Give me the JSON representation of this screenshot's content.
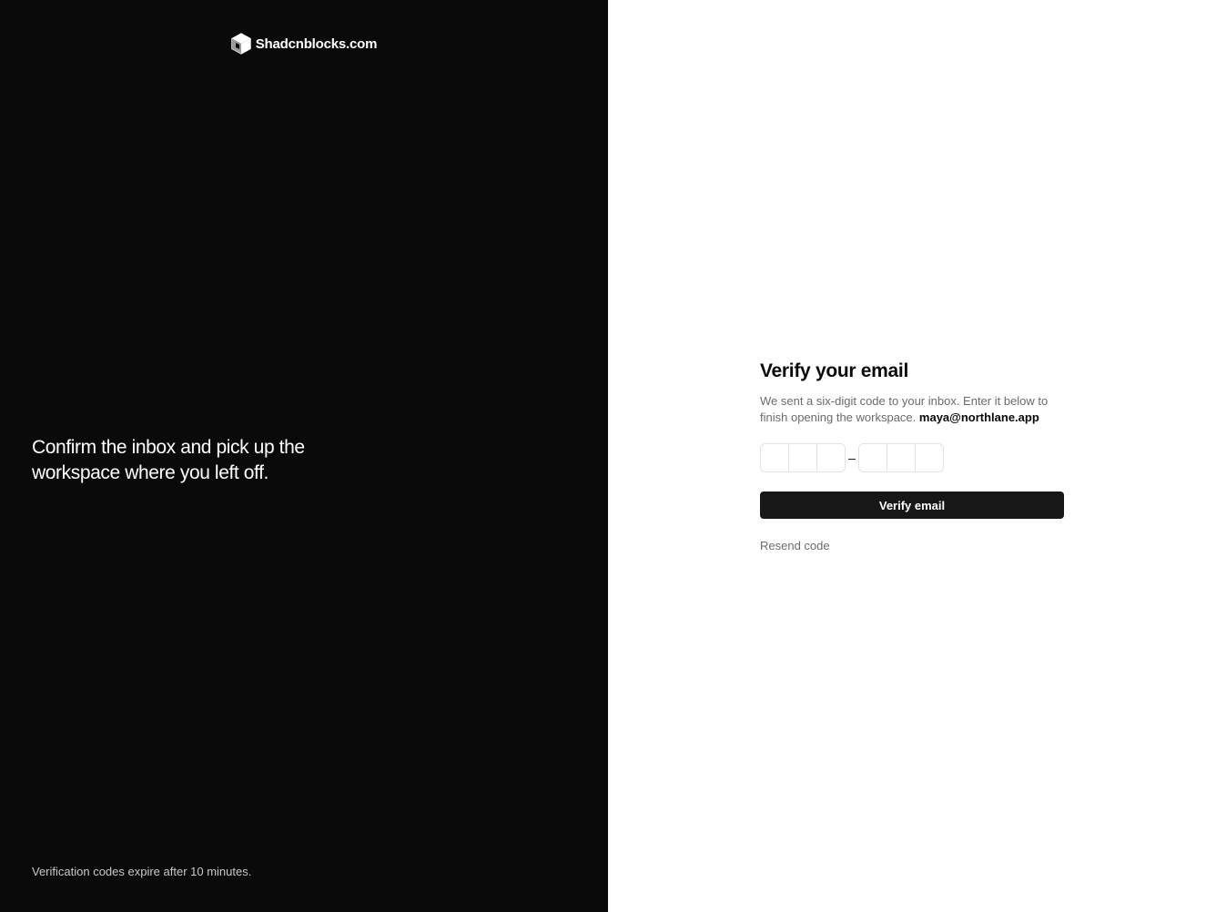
{
  "brand": {
    "name": "Shadcnblocks.com",
    "logo_icon": "shadcnblocks-cube-logo"
  },
  "left_panel": {
    "tagline": "Confirm the inbox and pick up the workspace where you left off.",
    "footnote": "Verification codes expire after 10 minutes."
  },
  "form": {
    "title": "Verify your email",
    "description": "We sent a six-digit code to your inbox. Enter it below to finish opening the workspace.",
    "email": "maya@northlane.app",
    "otp": {
      "separator": "–",
      "slots": [
        "",
        "",
        "",
        "",
        "",
        ""
      ]
    },
    "verify_label": "Verify email",
    "resend_label": "Resend code"
  },
  "colors": {
    "left_bg": "#0a0a0a",
    "right_bg": "#ffffff",
    "button_bg": "#171717",
    "muted_text": "#6b6b6b"
  }
}
